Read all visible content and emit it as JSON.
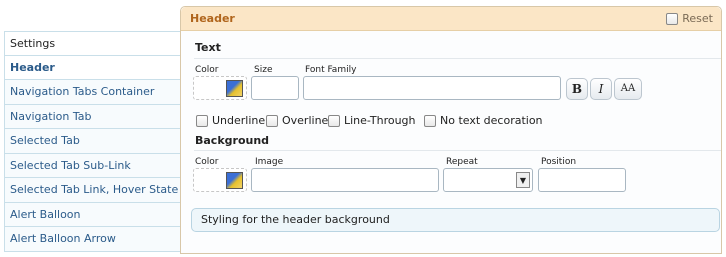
{
  "sidebar": {
    "heading": "Settings",
    "items": [
      {
        "label": "Header",
        "active": true
      },
      {
        "label": "Navigation Tabs Container"
      },
      {
        "label": "Navigation Tab"
      },
      {
        "label": "Selected Tab"
      },
      {
        "label": "Selected Tab Sub-Link"
      },
      {
        "label": "Selected Tab Link, Hover State"
      },
      {
        "label": "Alert Balloon"
      },
      {
        "label": "Alert Balloon Arrow"
      }
    ]
  },
  "panel": {
    "title": "Header",
    "reset_label": "Reset",
    "text_section": {
      "title": "Text",
      "color_label": "Color",
      "size_label": "Size",
      "font_family_label": "Font Family",
      "size_value": "",
      "font_family_value": "",
      "bold_label": "B",
      "italic_label": "I",
      "case_label": "AA",
      "decorations": [
        "Underline",
        "Overline",
        "Line-Through",
        "No text decoration"
      ]
    },
    "background_section": {
      "title": "Background",
      "color_label": "Color",
      "image_label": "Image",
      "repeat_label": "Repeat",
      "position_label": "Position",
      "image_value": "",
      "repeat_value": "",
      "position_value": ""
    },
    "description": "Styling for the header background"
  },
  "colors": {
    "accent_header_bg": "#fbe6c6",
    "accent_header_text": "#b0651c",
    "link_text": "#2b5b8a",
    "note_bg": "#eef6fa"
  }
}
